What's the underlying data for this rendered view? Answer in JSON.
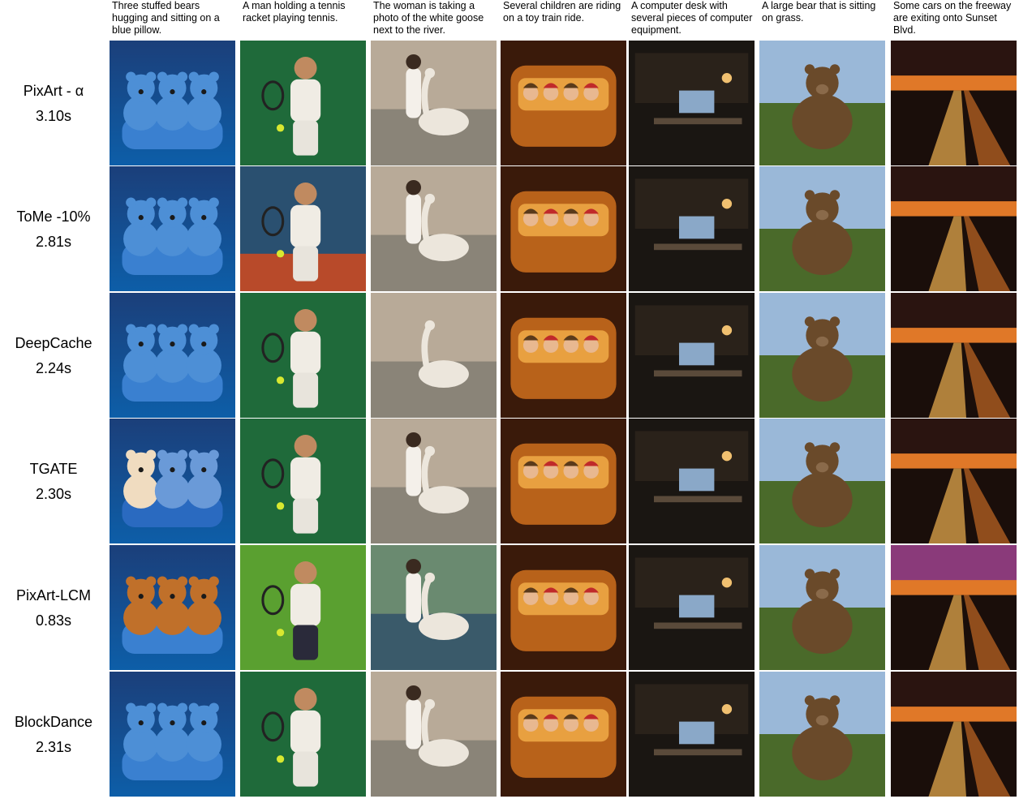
{
  "prompts": [
    "Three stuffed bears hugging and sitting on a blue pillow.",
    "A man holding a tennis racket playing tennis.",
    "The woman is taking a photo of the white goose next to the river.",
    "Several children are riding on a toy train ride.",
    "A computer desk with several pieces of computer equipment.",
    "A large bear that is sitting on grass.",
    "Some cars on the freeway are exiting onto Sunset Blvd."
  ],
  "methods": [
    {
      "name": "PixArt - α",
      "time": "3.10s"
    },
    {
      "name": "ToMe -10%",
      "time": "2.81s"
    },
    {
      "name": "DeepCache",
      "time": "2.24s"
    },
    {
      "name": "TGATE",
      "time": "2.30s"
    },
    {
      "name": "PixArt-LCM",
      "time": "0.83s"
    },
    {
      "name": "BlockDance",
      "time": "2.31s"
    }
  ],
  "image_colors": {
    "bears": [
      "#0d5ea8",
      "#4d8fd6",
      "#1b3f7a"
    ],
    "tennis": [
      "#1f6a3a",
      "#e9e2d6",
      "#0f3a20"
    ],
    "goose": [
      "#b8aa98",
      "#ece6dc",
      "#5f5a52"
    ],
    "train": [
      "#b8621a",
      "#e8a040",
      "#3a1a0a"
    ],
    "desk": [
      "#1a1612",
      "#5a4a3a",
      "#8aa8c8"
    ],
    "bear": [
      "#4a6a2a",
      "#6a4a2a",
      "#9ab8d8"
    ],
    "cars": [
      "#2a1410",
      "#e07828",
      "#f0b050"
    ]
  },
  "image_subjects": [
    "bears",
    "tennis",
    "goose",
    "train",
    "desk",
    "bear",
    "cars"
  ]
}
